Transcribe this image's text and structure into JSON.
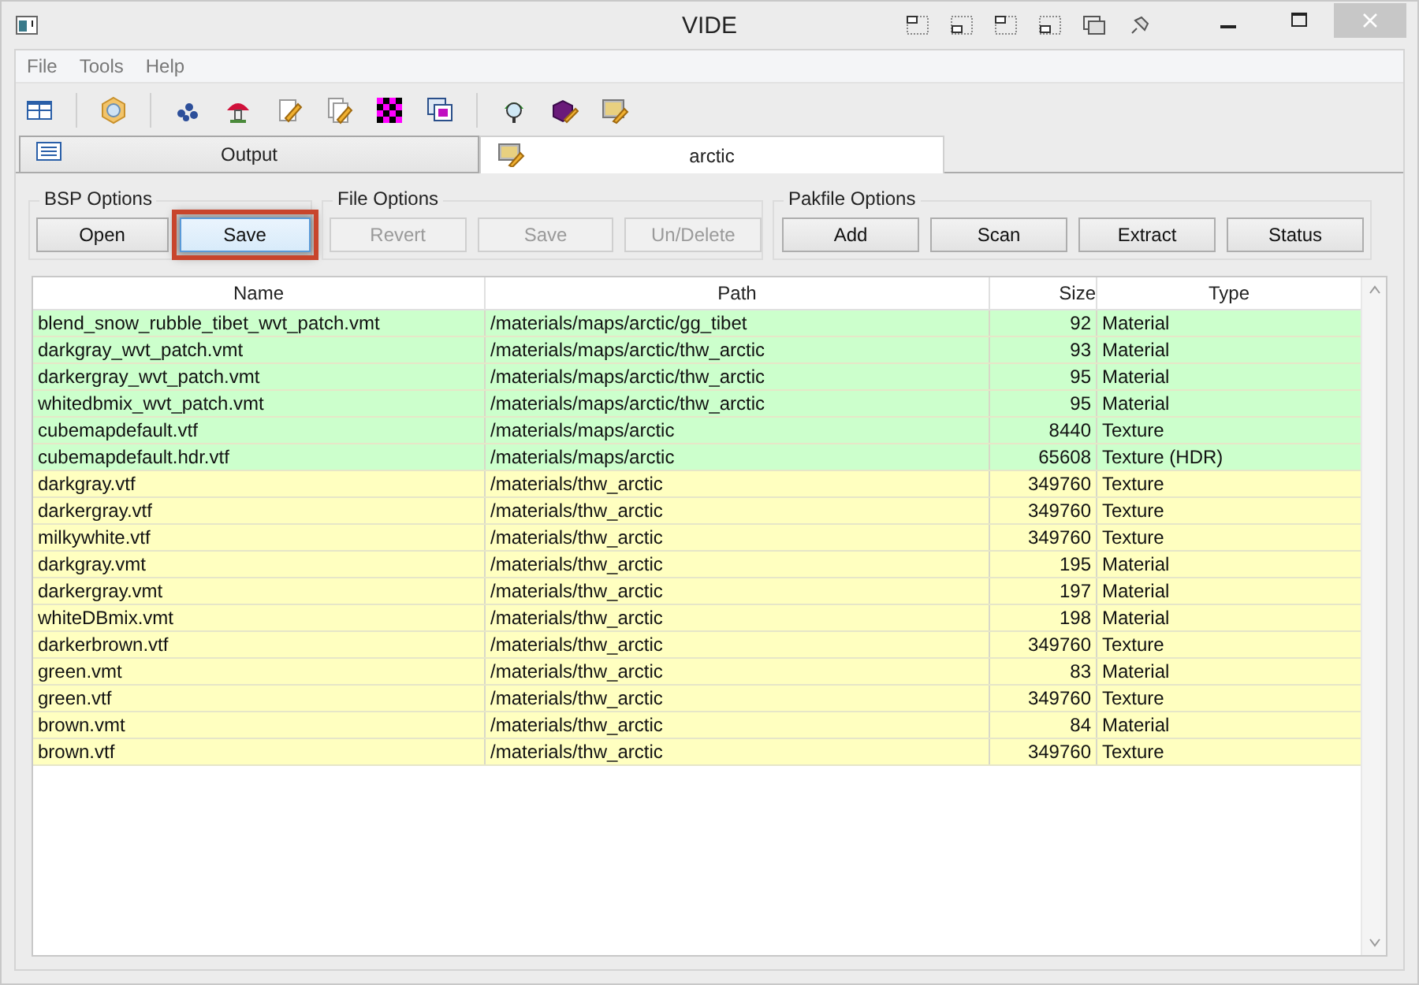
{
  "window": {
    "title": "VIDE"
  },
  "menu": [
    {
      "label": "File"
    },
    {
      "label": "Tools"
    },
    {
      "label": "Help"
    }
  ],
  "tabs": [
    {
      "label": "Output",
      "selected": false
    },
    {
      "label": "arctic",
      "selected": true
    }
  ],
  "option_groups": [
    {
      "title": "BSP Options",
      "buttons": [
        {
          "label": "Open",
          "disabled": false,
          "focused": false,
          "highlighted": false
        },
        {
          "label": "Save",
          "disabled": false,
          "focused": true,
          "highlighted": true
        }
      ]
    },
    {
      "title": "File Options",
      "buttons": [
        {
          "label": "Revert",
          "disabled": true,
          "focused": false,
          "highlighted": false
        },
        {
          "label": "Save",
          "disabled": true,
          "focused": false,
          "highlighted": false
        },
        {
          "label": "Un/Delete",
          "disabled": true,
          "focused": false,
          "highlighted": false
        }
      ]
    },
    {
      "title": "Pakfile Options",
      "buttons": [
        {
          "label": "Add",
          "disabled": false,
          "focused": false,
          "highlighted": false
        },
        {
          "label": "Scan",
          "disabled": false,
          "focused": false,
          "highlighted": false
        },
        {
          "label": "Extract",
          "disabled": false,
          "focused": false,
          "highlighted": false
        },
        {
          "label": "Status",
          "disabled": false,
          "focused": false,
          "highlighted": false
        }
      ]
    }
  ],
  "table": {
    "columns": [
      "Name",
      "Path",
      "Size",
      "Type"
    ],
    "rows": [
      {
        "name": "blend_snow_rubble_tibet_wvt_patch.vmt",
        "path": "/materials/maps/arctic/gg_tibet",
        "size": "92",
        "type": "Material",
        "color": "#ccffcc"
      },
      {
        "name": "darkgray_wvt_patch.vmt",
        "path": "/materials/maps/arctic/thw_arctic",
        "size": "93",
        "type": "Material",
        "color": "#ccffcc"
      },
      {
        "name": "darkergray_wvt_patch.vmt",
        "path": "/materials/maps/arctic/thw_arctic",
        "size": "95",
        "type": "Material",
        "color": "#ccffcc"
      },
      {
        "name": "whitedbmix_wvt_patch.vmt",
        "path": "/materials/maps/arctic/thw_arctic",
        "size": "95",
        "type": "Material",
        "color": "#ccffcc"
      },
      {
        "name": "cubemapdefault.vtf",
        "path": "/materials/maps/arctic",
        "size": "8440",
        "type": "Texture",
        "color": "#ccffcc"
      },
      {
        "name": "cubemapdefault.hdr.vtf",
        "path": "/materials/maps/arctic",
        "size": "65608",
        "type": "Texture (HDR)",
        "color": "#ccffcc"
      },
      {
        "name": "darkgray.vtf",
        "path": "/materials/thw_arctic",
        "size": "349760",
        "type": "Texture",
        "color": "#ffffc0"
      },
      {
        "name": "darkergray.vtf",
        "path": "/materials/thw_arctic",
        "size": "349760",
        "type": "Texture",
        "color": "#ffffc0"
      },
      {
        "name": "milkywhite.vtf",
        "path": "/materials/thw_arctic",
        "size": "349760",
        "type": "Texture",
        "color": "#ffffc0"
      },
      {
        "name": "darkgray.vmt",
        "path": "/materials/thw_arctic",
        "size": "195",
        "type": "Material",
        "color": "#ffffc0"
      },
      {
        "name": "darkergray.vmt",
        "path": "/materials/thw_arctic",
        "size": "197",
        "type": "Material",
        "color": "#ffffc0"
      },
      {
        "name": "whiteDBmix.vmt",
        "path": "/materials/thw_arctic",
        "size": "198",
        "type": "Material",
        "color": "#ffffc0"
      },
      {
        "name": "darkerbrown.vtf",
        "path": "/materials/thw_arctic",
        "size": "349760",
        "type": "Texture",
        "color": "#ffffc0"
      },
      {
        "name": "green.vmt",
        "path": "/materials/thw_arctic",
        "size": "83",
        "type": "Material",
        "color": "#ffffc0"
      },
      {
        "name": "green.vtf",
        "path": "/materials/thw_arctic",
        "size": "349760",
        "type": "Texture",
        "color": "#ffffc0"
      },
      {
        "name": "brown.vmt",
        "path": "/materials/thw_arctic",
        "size": "84",
        "type": "Material",
        "color": "#ffffc0"
      },
      {
        "name": "brown.vtf",
        "path": "/materials/thw_arctic",
        "size": "349760",
        "type": "Texture",
        "color": "#ffffc0"
      }
    ]
  }
}
